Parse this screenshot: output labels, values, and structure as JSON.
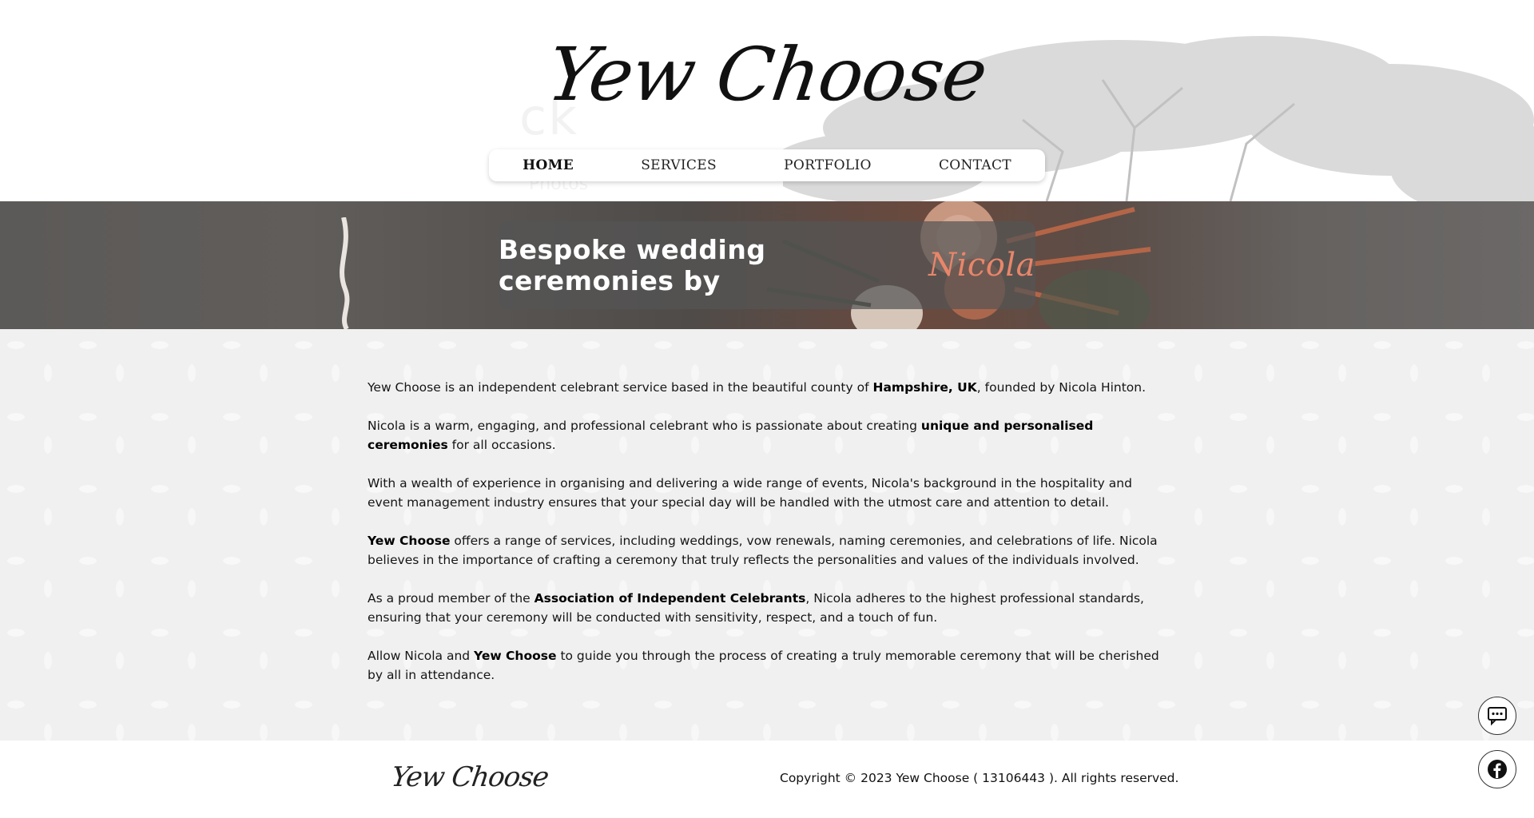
{
  "header": {
    "logo_text": "Yew Choose",
    "nav": [
      {
        "label": "HOME",
        "active": true
      },
      {
        "label": "SERVICES",
        "active": false
      },
      {
        "label": "PORTFOLIO",
        "active": false
      },
      {
        "label": "CONTACT",
        "active": false
      }
    ]
  },
  "hero": {
    "banner_text": "Bespoke wedding ceremonies by",
    "banner_name": "Nicola",
    "accent_color": "#e8866a"
  },
  "content": {
    "p1": {
      "a": "Yew Choose is an independent celebrant service based in the beautiful county of ",
      "b": "Hampshire, UK",
      "c": ", founded by Nicola Hinton."
    },
    "p2": {
      "a": "Nicola is a warm, engaging, and professional celebrant who is passionate about creating ",
      "b": "unique and personalised ceremonies",
      "c": " for all occasions."
    },
    "p3": {
      "a": "With a wealth of experience in organising and delivering a wide range of events, Nicola's background in the hospitality and event management industry ensures that your special day will be handled with the utmost care and attention to detail."
    },
    "p4": {
      "b": "Yew Choose",
      "c": " offers a range of services, including weddings, vow renewals, naming ceremonies, and celebrations of life. Nicola believes in the importance of crafting a ceremony that truly reflects the personalities and values of the individuals involved."
    },
    "p5": {
      "a": "As a proud member of the ",
      "b": "Association of Independent Celebrants",
      "c": ", Nicola adheres to the highest professional standards, ensuring that your ceremony will be conducted with sensitivity, respect, and a touch of fun."
    },
    "p6": {
      "a": "Allow Nicola and ",
      "b": "Yew Choose",
      "c": " to guide you through the process of creating a truly memorable ceremony that will be cherished by all in attendance."
    }
  },
  "footer": {
    "logo_text": "Yew Choose",
    "copyright": "Copyright © 2023 Yew Choose ( 13106443 ). All rights reserved."
  },
  "floating": {
    "chat_icon": "chat-bubble-icon",
    "facebook_icon": "facebook-icon"
  }
}
